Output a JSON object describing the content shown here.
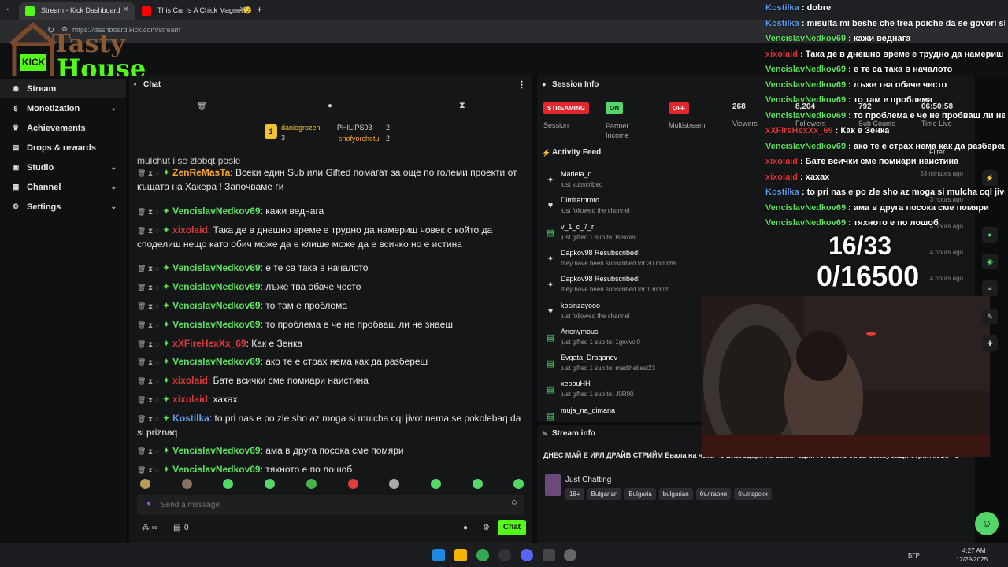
{
  "browser": {
    "tabs": [
      {
        "title": "Stream - Kick Dashboard"
      },
      {
        "title": "This Car Is A Chick Magnet😉"
      }
    ],
    "url": "https://dashboard.kick.com/stream"
  },
  "logo": {
    "text_top": "Tasty",
    "text_bottom": "House",
    "kick": "KICK"
  },
  "sidebar": {
    "items": [
      {
        "label": "Stream",
        "icon": "broadcast-icon"
      },
      {
        "label": "Monetization",
        "icon": "dollar-icon"
      },
      {
        "label": "Achievements",
        "icon": "trophy-icon"
      },
      {
        "label": "Drops & rewards",
        "icon": "gift-icon"
      },
      {
        "label": "Studio",
        "icon": "clapper-icon"
      },
      {
        "label": "Channel",
        "icon": "layout-icon"
      },
      {
        "label": "Settings",
        "icon": "gear-icon"
      }
    ]
  },
  "chat": {
    "title": "Chat",
    "top_supporters": [
      {
        "rank": "1",
        "name": "daniegrozen",
        "count": "3"
      },
      {
        "name": "PHILIPS03",
        "count": "2"
      },
      {
        "name": "shofyorchetu",
        "count": "2"
      }
    ],
    "partial_line": "mulchut i se zlobqt posle",
    "messages": [
      {
        "user": "ZenReMasTa",
        "color": "#f2a531",
        "text": "Всеки един Sub или Gifted помагат за още по големи проекти от къщата на Хакера ! Започваме ги"
      },
      {
        "user": "VencislavNedkov69",
        "color": "#5ee15e",
        "text": "кажи веднага"
      },
      {
        "user": "xixolaid",
        "color": "#d9393b",
        "text": "Така де в днешно време е трудно да намериш човек с който да споделиш нещо като обич може да е клише може да е всичко но е истина"
      },
      {
        "user": "VencislavNedkov69",
        "color": "#5ee15e",
        "text": "е те са така в началото"
      },
      {
        "user": "VencislavNedkov69",
        "color": "#5ee15e",
        "text": "лъже тва обаче често"
      },
      {
        "user": "VencislavNedkov69",
        "color": "#5ee15e",
        "text": "то там е проблема"
      },
      {
        "user": "VencislavNedkov69",
        "color": "#5ee15e",
        "text": "то проблема е че не пробваш ли не знаеш"
      },
      {
        "user": "xXFireHexXx_69",
        "color": "#d9393b",
        "text": "Как е Зенка"
      },
      {
        "user": "VencislavNedkov69",
        "color": "#5ee15e",
        "text": "ако те е страх нема как да разбереш"
      },
      {
        "user": "xixolaid",
        "color": "#d9393b",
        "text": "Бате всички сме помиари наистина"
      },
      {
        "user": "xixolaid",
        "color": "#d9393b",
        "text": "хахах"
      },
      {
        "user": "Kostilka",
        "color": "#5a9df0",
        "text": "to pri nas e po zle sho az moga si mulcha cql jivot nema se pokolebaq da si priznaq"
      },
      {
        "user": "VencislavNedkov69",
        "color": "#5ee15e",
        "text": "ама в друга посока сме помяри"
      },
      {
        "user": "VencislavNedkov69",
        "color": "#5ee15e",
        "text": "тяхното е по лошоб"
      }
    ],
    "input_placeholder": "Send a message",
    "footer": {
      "points": "0",
      "send_label": "Chat"
    }
  },
  "session": {
    "title": "Session Info",
    "stats": [
      {
        "badge": "STREAMING",
        "badge_color": "#e1262c",
        "label": "Session"
      },
      {
        "badge": "ON",
        "badge_color": "#53d769",
        "label": "Partner Income"
      },
      {
        "badge": "OFF",
        "badge_color": "#e1262c",
        "label": "Multistream"
      },
      {
        "value": "268",
        "label": "Viewers"
      },
      {
        "value": "8,204",
        "label": "Followers"
      },
      {
        "value": "792",
        "label": "Sub Counts"
      },
      {
        "value": "06:50:58",
        "label": "Time Live"
      }
    ],
    "filter_label": "Filter",
    "activity_title": "Activity Feed",
    "feed": [
      {
        "icon": "star-icon",
        "title": "Mariela_d",
        "sub": "just subscribed",
        "time": "53 minutes ago"
      },
      {
        "icon": "heart-icon",
        "title": "Dimitarproto",
        "sub": "just followed the channel",
        "time": "3 hours ago"
      },
      {
        "icon": "gift-icon",
        "title": "v_1_c_7_r",
        "sub": "just gifted 1 sub to: tsekovv",
        "time": "4 hours ago"
      },
      {
        "icon": "star-icon",
        "title": "Dapkov98 Resubscribed!",
        "sub": "they have been subscribed for 20 months",
        "time": "4 hours ago"
      },
      {
        "icon": "star-icon",
        "title": "Dapkov98 Resubscribed!",
        "sub": "they have been subscribed for 1 month",
        "time": "4 hours ago"
      },
      {
        "icon": "heart-icon",
        "title": "kosinzayooo",
        "sub": "just followed the channel",
        "time": ""
      },
      {
        "icon": "gift-icon",
        "title": "Anonymous",
        "sub": "just gifted 1 sub to: 1gnvvci0",
        "time": ""
      },
      {
        "icon": "gift-icon",
        "title": "Evgata_Draganov",
        "sub": "just gifted 1 sub to: madthebest23",
        "time": ""
      },
      {
        "icon": "gift-icon",
        "title": "xepouHH",
        "sub": "just gifted 1 sub to: J0R00",
        "time": ""
      },
      {
        "icon": "gift-icon",
        "title": "muja_na_dimana",
        "sub": "",
        "time": ""
      }
    ]
  },
  "stream_info": {
    "title": "Stream info",
    "stream_title": "ДНЕС МАЙ Е ИРЛ ДРАЙВ СТРИЙМ Евала на чата <3 Благодаря на всеки един готовете са за вълнуващи стриймове <3",
    "category": "Just Chatting",
    "tags": [
      "18+",
      "Bulgarian",
      "Bulgaria",
      "bulgarian",
      "българия",
      "български"
    ]
  },
  "overlay": {
    "goal_subs": "16/33",
    "goal_kicks": "0/16500",
    "chat": [
      {
        "user": "Kostilka",
        "color": "#5a9df0",
        "text": "dobre"
      },
      {
        "user": "Kostilka",
        "color": "#5a9df0",
        "text": "misulta mi beshe che trea poiche da se govori sho"
      },
      {
        "user": "VencislavNedkov69",
        "color": "#5ee15e",
        "text": "кажи веднага"
      },
      {
        "user": "xixolaid",
        "color": "#d9393b",
        "text": "Така де в днешно време е трудно да намериш чов"
      },
      {
        "user": "VencislavNedkov69",
        "color": "#5ee15e",
        "text": "е те са така в началото"
      },
      {
        "user": "VencislavNedkov69",
        "color": "#5ee15e",
        "text": "лъже тва обаче често"
      },
      {
        "user": "VencislavNedkov69",
        "color": "#5ee15e",
        "text": "то там е проблема"
      },
      {
        "user": "VencislavNedkov69",
        "color": "#5ee15e",
        "text": "то проблема е че не пробваш ли не знаеш"
      },
      {
        "user": "xXFireHexXx_69",
        "color": "#d9393b",
        "text": "Как е Зенка"
      },
      {
        "user": "VencislavNedkov69",
        "color": "#5ee15e",
        "text": "ако те е страх нема как да разбереш"
      },
      {
        "user": "xixolaid",
        "color": "#d9393b",
        "text": "Бате всички сме помиари наистина"
      },
      {
        "user": "xixolaid",
        "color": "#d9393b",
        "text": "хахах"
      },
      {
        "user": "Kostilka",
        "color": "#5a9df0",
        "text": "to pri nas e po zle sho az moga si mulcha cql jivot"
      },
      {
        "user": "VencislavNedkov69",
        "color": "#5ee15e",
        "text": "ама в друга посока сме помяри"
      },
      {
        "user": "VencislavNedkov69",
        "color": "#5ee15e",
        "text": "тяхното е по лошоб"
      }
    ]
  },
  "taskbar": {
    "time": "4:27 AM",
    "date": "12/29/2025",
    "lang": "БГР"
  }
}
